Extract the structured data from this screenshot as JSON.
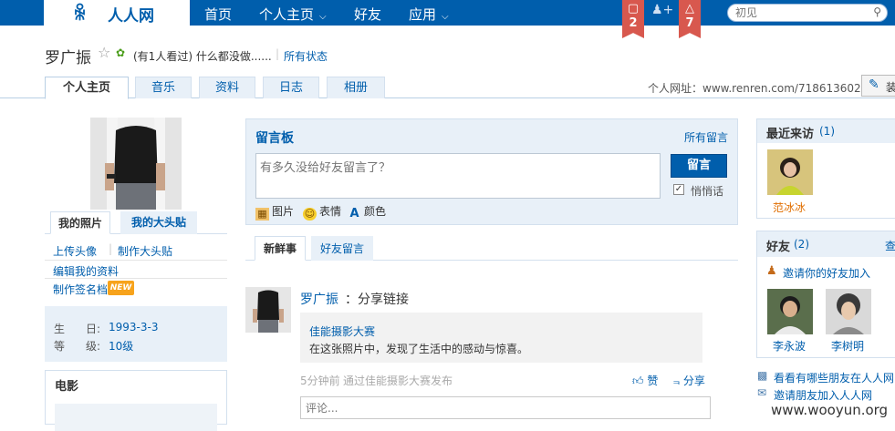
{
  "topnav": {
    "logo_text": "人人网",
    "items": [
      "首页",
      "个人主页",
      "好友",
      "应用"
    ],
    "chevron": "chevron-down-icon",
    "notifications": [
      {
        "icon": "chat-bubble-icon",
        "count": "2"
      },
      {
        "icon": "person-add-icon",
        "count": ""
      },
      {
        "icon": "bell-icon",
        "count": "7"
      }
    ],
    "search_placeholder": "初见",
    "search_icon": "search-icon"
  },
  "profile": {
    "name": "罗广振",
    "star_icon": "star-outline-icon",
    "vip_icon": "vip-leaf-icon",
    "visit_text": "(有1人看过) 什么都没做......",
    "all_status": "所有状态"
  },
  "tabs": [
    "个人主页",
    "音乐",
    "资料",
    "日志",
    "相册"
  ],
  "homepage": {
    "label": "个人网址：",
    "url": "www.renren.com/718613602",
    "button_icon": "edit-icon",
    "button_text": "装"
  },
  "left": {
    "photo_tabs": [
      "我的照片",
      "我的大头贴"
    ],
    "links": [
      "上传头像",
      "制作大头贴",
      "编辑我的资料",
      "制作签名档"
    ],
    "new_badge": "NEW",
    "info": [
      {
        "label": "生",
        "label2": "日:",
        "value": "1993-3-3"
      },
      {
        "label": "等",
        "label2": "级:",
        "value": "10级"
      }
    ],
    "movie_title": "电影"
  },
  "guestbook": {
    "title": "留言板",
    "all_link": "所有留言",
    "placeholder": "有多久没给好友留言了？",
    "submit": "留言",
    "whisper_checked": true,
    "whisper_label": "悄悄话",
    "tools": [
      {
        "icon": "picture-icon",
        "label": "图片"
      },
      {
        "icon": "emoji-icon",
        "label": "表情"
      },
      {
        "icon": "text-color-icon",
        "label": "颜色"
      }
    ]
  },
  "feed_tabs": [
    "新鲜事",
    "好友留言"
  ],
  "feed": {
    "author": "罗广振",
    "action": "：分享链接",
    "card_title": "佳能摄影大赛",
    "card_desc": "在这张照片中，发现了生活中的感动与惊喜。",
    "time": "5分钟前",
    "source": "通过佳能摄影大赛发布",
    "like": "赞",
    "like_icon": "thumbs-up-icon",
    "share": "分享",
    "share_icon": "share-icon",
    "comment_placeholder": "评论..."
  },
  "recent_visitors": {
    "title": "最近来访",
    "count": "(1)",
    "visitors": [
      {
        "name": "范冰冰"
      }
    ]
  },
  "friends": {
    "title": "好友",
    "count": "(2)",
    "see_all": "查",
    "invite": "邀请你的好友加入",
    "invite_icon": "person-plus-icon",
    "list": [
      {
        "name": "李永波"
      },
      {
        "name": "李树明"
      }
    ]
  },
  "right_links": [
    {
      "icon": "find-friends-icon",
      "text": "看看有哪些朋友在人人网"
    },
    {
      "icon": "invite-icon",
      "text": "邀请朋友加入人人网"
    }
  ],
  "watermark": "www.wooyun.org",
  "colors": {
    "brand": "#005eac",
    "notify": "#d8584e",
    "visitor_name": "#e06e00"
  }
}
